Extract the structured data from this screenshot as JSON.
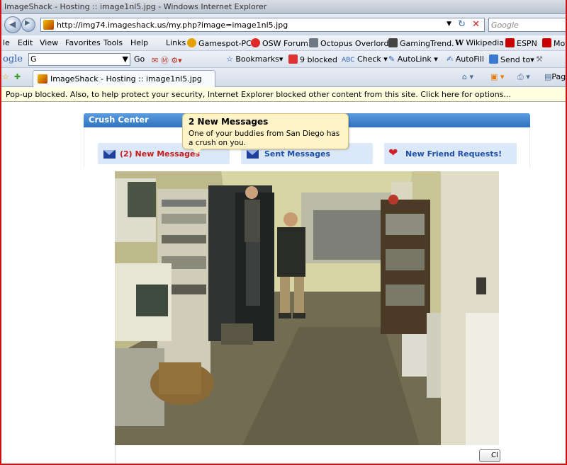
{
  "window": {
    "title": "ImageShack - Hosting :: image1nl5.jpg - Windows Internet Explorer"
  },
  "address": {
    "url": "http://img74.imageshack.us/my.php?image=image1nl5.jpg",
    "search_placeholder": "Google"
  },
  "menu": {
    "items": [
      "le",
      "Edit",
      "View",
      "Favorites",
      "Tools",
      "Help"
    ]
  },
  "links": {
    "label": "Links",
    "items": [
      "Gamespot-PC",
      "OSW Forum",
      "Octopus Overlords",
      "GamingTrend.",
      "Wikipedia",
      "ESPN",
      "Mot"
    ]
  },
  "google_toolbar": {
    "logo": "ogle",
    "search_value": "G",
    "go": "Go",
    "bookmarks": "Bookmarks",
    "blocked": "9 blocked",
    "check": "Check",
    "autolink": "AutoLink",
    "autofill": "AutoFill",
    "send_to": "Send to"
  },
  "tab": {
    "title": "ImageShack - Hosting :: image1nl5.jpg",
    "page_label": "Pag"
  },
  "infobar": {
    "text": "Pop-up blocked. Also, to help protect your security, Internet Explorer blocked other content from this site. Click here for options..."
  },
  "crush": {
    "header": "Crush Center",
    "new_messages": "(2) New Messages",
    "sent_messages": "Sent Messages",
    "friend_requests": "New Friend Requests!"
  },
  "bubble": {
    "title": "2 New Messages",
    "body": "One of your buddies from San Diego has a crush on you."
  },
  "page": {
    "close_label": "Cl"
  },
  "colors": {
    "accent": "#2f72bf",
    "info": "#ffffe1",
    "frame": "#c81414"
  }
}
